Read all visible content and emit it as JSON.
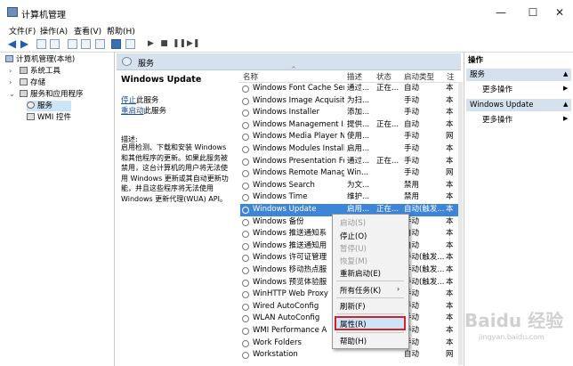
{
  "window": {
    "title": "计算机管理",
    "min": "—",
    "max": "☐",
    "close": "✕"
  },
  "menu": [
    "文件(F)",
    "操作(A)",
    "查看(V)",
    "帮助(H)"
  ],
  "tree": {
    "root": "计算机管理(本地)",
    "system_tools": "系统工具",
    "storage": "存储",
    "services_apps": "服务和应用程序",
    "services": "服务",
    "wmi": "WMI 控件"
  },
  "services_header": "服务",
  "desc": {
    "title": "Windows Update",
    "stop_link": "停止",
    "stop_suffix": "此服务",
    "restart_link": "重启动",
    "restart_suffix": "此服务",
    "label": "描述:",
    "text": "启用检测、下载和安装 Windows 和其他程序的更新。如果此服务被禁用，这台计算机的用户将无法使用 Windows 更新或其自动更新功能，并且这些程序将无法使用 Windows 更新代理(WUA) API。"
  },
  "columns": [
    "名称",
    "描述",
    "状态",
    "启动类型",
    "注"
  ],
  "rows": [
    {
      "name": "Windows Font Cache Ser...",
      "desc": "通过...",
      "status": "正在...",
      "start": "自动",
      "logon": "本"
    },
    {
      "name": "Windows Image Acquisiti...",
      "desc": "为扫...",
      "status": "",
      "start": "手动",
      "logon": "本"
    },
    {
      "name": "Windows Installer",
      "desc": "添加...",
      "status": "",
      "start": "手动",
      "logon": "本"
    },
    {
      "name": "Windows Management I...",
      "desc": "提供...",
      "status": "正在...",
      "start": "自动",
      "logon": "本"
    },
    {
      "name": "Windows Media Player N...",
      "desc": "使用...",
      "status": "",
      "start": "手动",
      "logon": "网"
    },
    {
      "name": "Windows Modules Install...",
      "desc": "启用...",
      "status": "",
      "start": "手动",
      "logon": "本"
    },
    {
      "name": "Windows Presentation Fo...",
      "desc": "通过...",
      "status": "正在...",
      "start": "手动",
      "logon": "本"
    },
    {
      "name": "Windows Remote Manag...",
      "desc": "Win...",
      "status": "",
      "start": "手动",
      "logon": "网"
    },
    {
      "name": "Windows Search",
      "desc": "为文...",
      "status": "",
      "start": "禁用",
      "logon": "本"
    },
    {
      "name": "Windows Time",
      "desc": "维护...",
      "status": "",
      "start": "禁用",
      "logon": "本"
    },
    {
      "name": "Windows Update",
      "desc": "启用...",
      "status": "正在...",
      "start": "自动(触发...",
      "logon": "本"
    },
    {
      "name": "Windows 备份",
      "desc": "",
      "status": "",
      "start": "手动",
      "logon": "本"
    },
    {
      "name": "Windows 推送通知系",
      "desc": "",
      "status": "",
      "start": "自动",
      "logon": "本"
    },
    {
      "name": "Windows 推送通知用",
      "desc": "",
      "status": "",
      "start": "自动",
      "logon": "本"
    },
    {
      "name": "Windows 许可证管理",
      "desc": "",
      "status": "",
      "start": "手动(触发...",
      "logon": "本"
    },
    {
      "name": "Windows 移动热点服",
      "desc": "",
      "status": "",
      "start": "手动(触发...",
      "logon": "本"
    },
    {
      "name": "Windows 预览体验服",
      "desc": "",
      "status": "",
      "start": "手动(触发...",
      "logon": "本"
    },
    {
      "name": "WinHTTP Web Proxy",
      "desc": "",
      "status": "",
      "start": "手动",
      "logon": "本"
    },
    {
      "name": "Wired AutoConfig",
      "desc": "",
      "status": "",
      "start": "手动",
      "logon": "本"
    },
    {
      "name": "WLAN AutoConfig",
      "desc": "",
      "status": "",
      "start": "手动",
      "logon": "本"
    },
    {
      "name": "WMI Performance A",
      "desc": "",
      "status": "",
      "start": "手动",
      "logon": "本"
    },
    {
      "name": "Work Folders",
      "desc": "",
      "status": "",
      "start": "手动",
      "logon": "本"
    },
    {
      "name": "Workstation",
      "desc": "",
      "status": "",
      "start": "自动",
      "logon": "网"
    }
  ],
  "context_menu": {
    "start": "启动(S)",
    "stop": "停止(O)",
    "pause": "暂停(U)",
    "resume": "恢复(M)",
    "restart": "重新启动(E)",
    "all_tasks": "所有任务(K)",
    "refresh": "刷新(F)",
    "properties": "属性(R)",
    "help": "帮助(H)"
  },
  "actions": {
    "title": "操作",
    "section1": "服务",
    "more1": "更多操作",
    "section2": "Windows Update",
    "more2": "更多操作"
  },
  "watermark": "Baidu 经验",
  "watermark_url": "jingyan.baidu.com",
  "colors": {
    "selection": "#3d85d6",
    "header_bg": "#d6e1ee",
    "highlight_border": "#d2232a"
  }
}
